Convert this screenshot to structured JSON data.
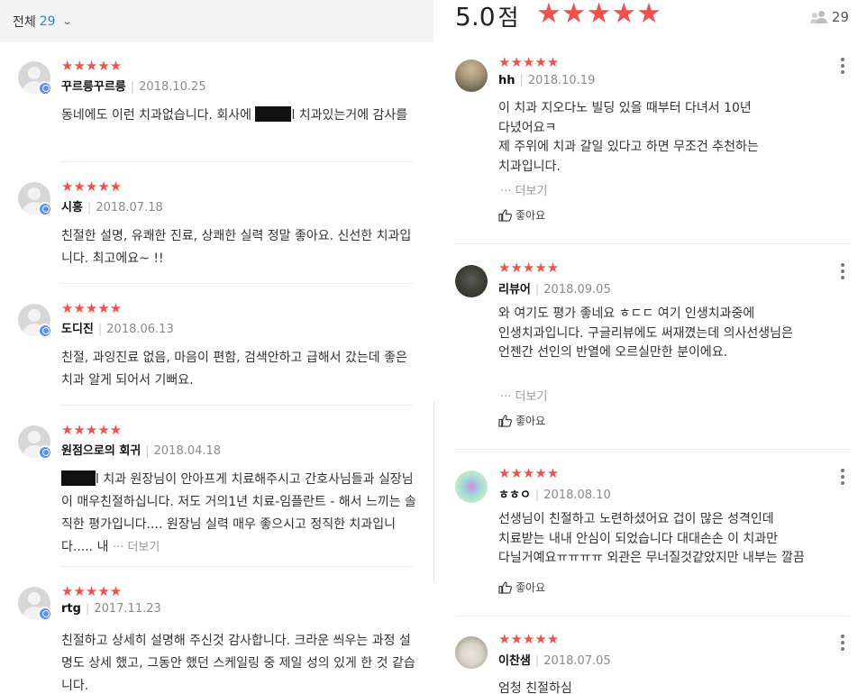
{
  "left_panel": {
    "filter_label": "전체",
    "filter_count": "29",
    "reviews": [
      {
        "stars": "★★★★★",
        "name": "꾸르릉꾸르릉",
        "date": "2018.10.25",
        "text_a": "동네에도 이런 치과없습니다.  회사에 ",
        "text_b": "l 치과있는거에 감사를"
      },
      {
        "stars": "★★★★★",
        "name": "시홍",
        "date": "2018.07.18",
        "text": "친절한 설명, 유쾌한 진료, 상쾌한 실력 정말 좋아요.  신선한 치과입니다. 최고에요~ !!"
      },
      {
        "stars": "★★★★★",
        "name": "도디진",
        "date": "2018.06.13",
        "text": "친절, 과잉진료 없음, 마음이 편함, 검색안하고 급해서 갔는데 좋은 치과 알게 되어서 기뻐요."
      },
      {
        "stars": "★★★★★",
        "name": "원점으로의 회귀",
        "date": "2018.04.18",
        "text_a": "l 치과 원장님이 안아프게 치료해주시고 간호사님들과 실장님이 매우친절하십니다. 저도 거의1년 치료-임플란트 - 해서 느끼는 솔직한 평가입니다.... 원장님 실력 매우 좋으시고 정직한 치과입니다..... 내 ",
        "more": "··· 더보기"
      },
      {
        "stars": "★★★★★",
        "name": "rtg",
        "date": "2017.11.23",
        "text": "친절하고 상세히 설명해 주신것 감사합니다. 크라운 씌우는 과정 설명도 상세 했고, 그동안 했던 스케일링 중 제일 성의 있게 한 것 같습니다."
      }
    ]
  },
  "right_panel": {
    "score": "5.0",
    "score_unit": "점",
    "summary_stars": "★★★★★",
    "review_count": "29",
    "reviews": [
      {
        "stars": "★★★★★",
        "name": "hh",
        "date": "2018.10.19",
        "line1": "이 치과 지오다노 빌딩 있을 때부터 다녀서 10년",
        "line2": "다녔어요ㅋ",
        "line3": "제 주위에 치과 갈일 있다고 하면 무조건 추천하는",
        "line4": "치과입니다.",
        "more": "··· 더보기",
        "like": "좋아요"
      },
      {
        "stars": "★★★★★",
        "name": "리뷰어",
        "date": "2018.09.05",
        "line1": "와 여기도 평가 좋네요 ㅎㄷㄷ 여기 인생치과중에",
        "line2": "인생치과입니다. 구글리뷰에도 써재꼈는데 의사선생님은",
        "line3": "언젠간 선인의 반열에 오르실만한 분이에요.",
        "more": "··· 더보기",
        "like": "좋아요"
      },
      {
        "stars": "★★★★★",
        "name": "ㅎㅎㅇ",
        "date": "2018.08.10",
        "line1": "선생님이 친절하고 노련하셨어요 겁이 많은 성격인데",
        "line2": "치료받는 내내 안심이 되었습니다 대대손손 이 치과만",
        "line3": "다닐거예요ㅠㅠㅠㅠ 외관은 무너질것같았지만 내부는 깔끔",
        "like": "좋아요"
      },
      {
        "stars": "★★★★★",
        "name": "이찬샘",
        "date": "2018.07.05",
        "line1": "엄청 친절하심"
      }
    ]
  },
  "colors": {
    "star": "#f0514e",
    "accent": "#2f7fe0",
    "pin": "#5b8ff0"
  },
  "icons": [
    "chevron-down-icon",
    "location-pin-icon",
    "people-icon",
    "thumbs-up-icon",
    "kebab-menu-icon"
  ]
}
